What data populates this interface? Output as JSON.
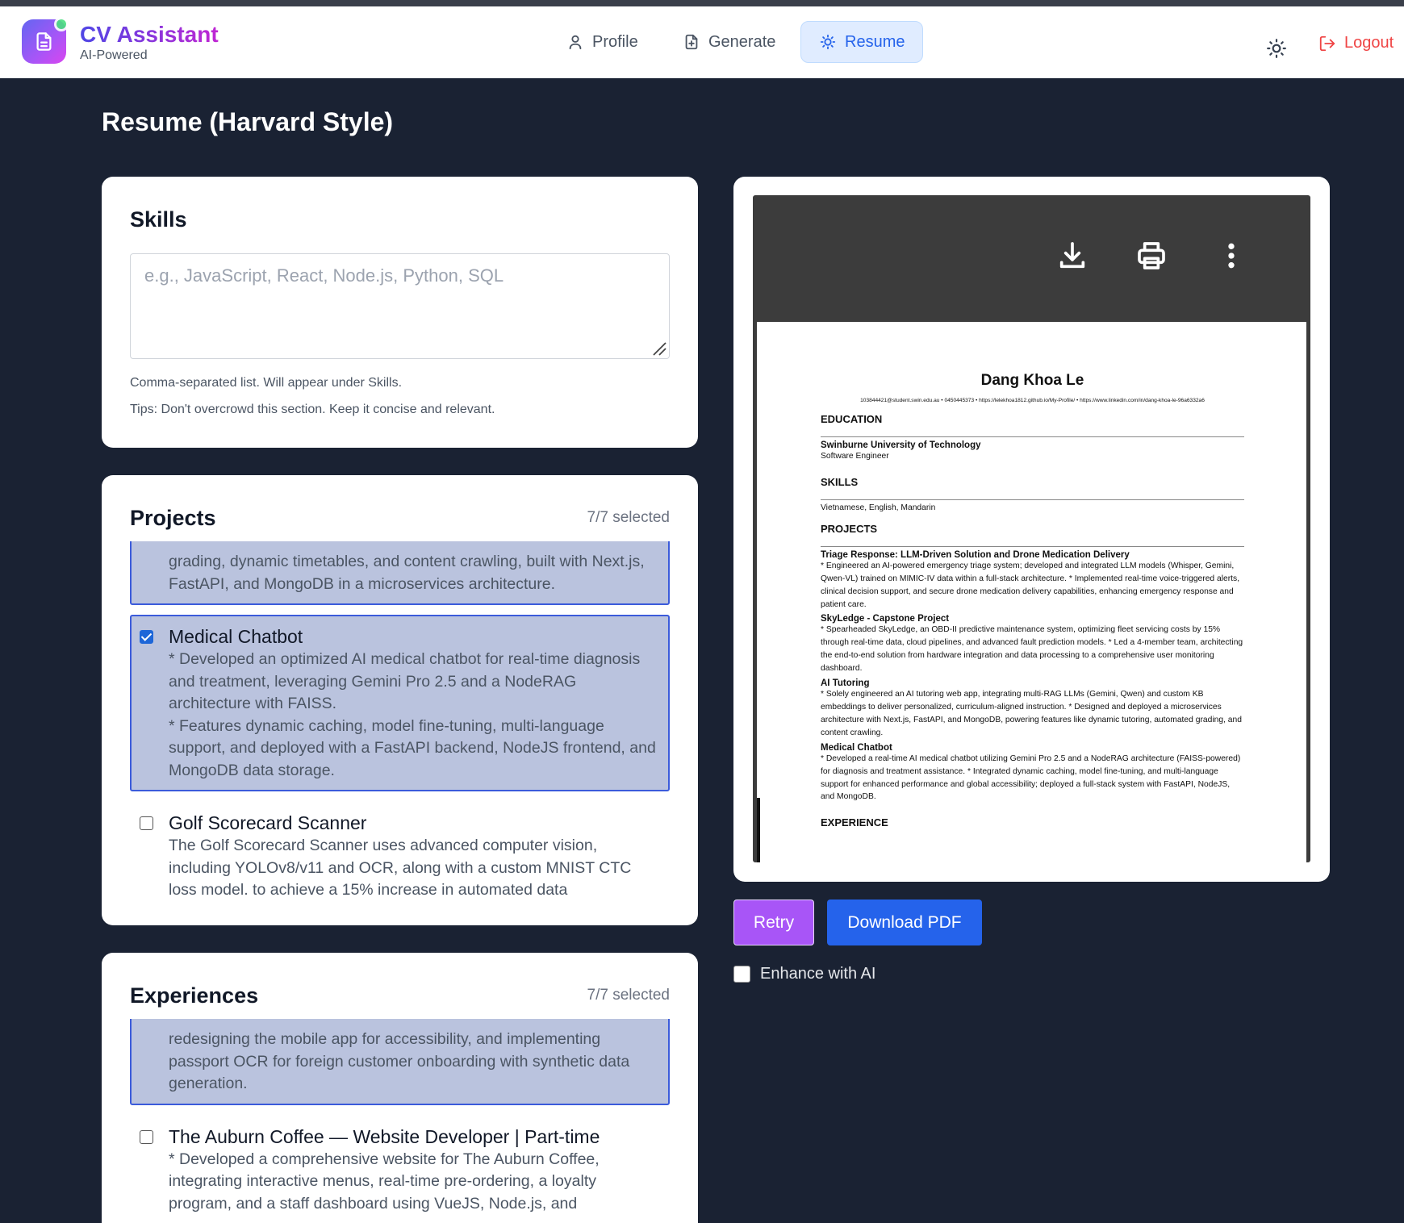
{
  "app": {
    "title": "CV Assistant",
    "subtitle": "AI-Powered"
  },
  "nav": [
    {
      "label": "Profile",
      "icon": "user-icon"
    },
    {
      "label": "Generate",
      "icon": "file-plus-icon"
    },
    {
      "label": "Resume",
      "icon": "lightbulb-icon",
      "active": true
    }
  ],
  "header_actions": {
    "theme_icon": "sun-icon",
    "logout_label": "Logout"
  },
  "page_title": "Resume (Harvard Style)",
  "skills": {
    "heading": "Skills",
    "placeholder": "e.g., JavaScript, React, Node.js, Python, SQL",
    "hint1": "Comma-separated list. Will appear under Skills.",
    "hint2": "Tips: Don't overcrowd this section. Keep it concise and relevant."
  },
  "projects": {
    "heading": "Projects",
    "count": "7/7 selected",
    "items": [
      {
        "title": "",
        "selected": true,
        "description": "grading, dynamic timetables, and content crawling, built with Next.js, FastAPI, and MongoDB in a microservices architecture."
      },
      {
        "title": "Medical Chatbot",
        "selected": true,
        "description": "*   Developed an optimized AI medical chatbot for real-time diagnosis and treatment, leveraging Gemini Pro 2.5 and a NodeRAG architecture with FAISS.\n*   Features dynamic caching, model fine-tuning, multi-language support, and deployed with a FastAPI backend, NodeJS frontend, and MongoDB data storage."
      },
      {
        "title": "Golf Scorecard Scanner",
        "selected": false,
        "description": "The Golf Scorecard Scanner uses advanced computer vision, including YOLOv8/v11 and OCR, along with a custom MNIST CTC loss model, to achieve a 15% increase in automated data"
      }
    ]
  },
  "experiences": {
    "heading": "Experiences",
    "count": "7/7 selected",
    "items": [
      {
        "title": "",
        "selected": true,
        "description": "redesigning the mobile app for accessibility, and implementing passport OCR for foreign customer onboarding with synthetic data generation."
      },
      {
        "title": "The Auburn Coffee — Website Developer | Part-time",
        "selected": false,
        "description": "*   Developed a comprehensive website for The Auburn Coffee, integrating interactive menus, real-time pre-ordering, a loyalty program, and a staff dashboard using VueJS, Node.js, and"
      }
    ]
  },
  "viewer": {
    "tools": [
      "download-icon",
      "print-icon",
      "more-vertical-icon"
    ]
  },
  "cv": {
    "name": "Dang Khoa Le",
    "contact": "103844421@student.swin.edu.au • 0450445373 • https://lelekhoa1812.github.io/My-Profile/ • https://www.linkedin.com/in/dang-khoa-le-96a6332a6",
    "education_heading": "EDUCATION",
    "school": "Swinburne University of Technology",
    "degree": "Software Engineer",
    "skills_heading": "SKILLS",
    "skills_text": "Vietnamese, English, Mandarin",
    "projects_heading": "PROJECTS",
    "projects": [
      {
        "title": "Triage Response: LLM-Driven Solution and Drone Medication Delivery",
        "text": "* Engineered an AI-powered emergency triage system; developed and integrated LLM models (Whisper, Gemini, Qwen-VL) trained on MIMIC-IV data within a full-stack architecture. * Implemented real-time voice-triggered alerts, clinical decision support, and secure drone medication delivery capabilities, enhancing emergency response and patient care."
      },
      {
        "title": "SkyLedge - Capstone Project",
        "text": "* Spearheaded SkyLedge, an OBD-II predictive maintenance system, optimizing fleet servicing costs by 15% through real-time data, cloud pipelines, and advanced fault prediction models. * Led a 4-member team, architecting the end-to-end solution from hardware integration and data processing to a comprehensive user monitoring dashboard."
      },
      {
        "title": "AI Tutoring",
        "text": "* Solely engineered an AI tutoring web app, integrating multi-RAG LLMs (Gemini, Qwen) and custom KB embeddings to deliver personalized, curriculum-aligned instruction. * Designed and deployed a microservices architecture with Next.js, FastAPI, and MongoDB, powering features like dynamic tutoring, automated grading, and content crawling."
      },
      {
        "title": "Medical Chatbot",
        "text": "* Developed a real-time AI medical chatbot utilizing Gemini Pro 2.5 and a NodeRAG architecture (FAISS-powered) for diagnosis and treatment assistance. * Integrated dynamic caching, model fine-tuning, and multi-language support for enhanced performance and global accessibility; deployed a full-stack system with FastAPI, NodeJS, and MongoDB."
      }
    ],
    "experience_heading": "EXPERIENCE"
  },
  "actions": {
    "retry": "Retry",
    "download_pdf": "Download PDF",
    "enhance_label": "Enhance with AI"
  },
  "colors": {
    "accent": "#2563eb",
    "retry": "#a855f7",
    "logout": "#ef4444",
    "selected_bg": "#bac3de",
    "page_bg": "#1a2233"
  }
}
